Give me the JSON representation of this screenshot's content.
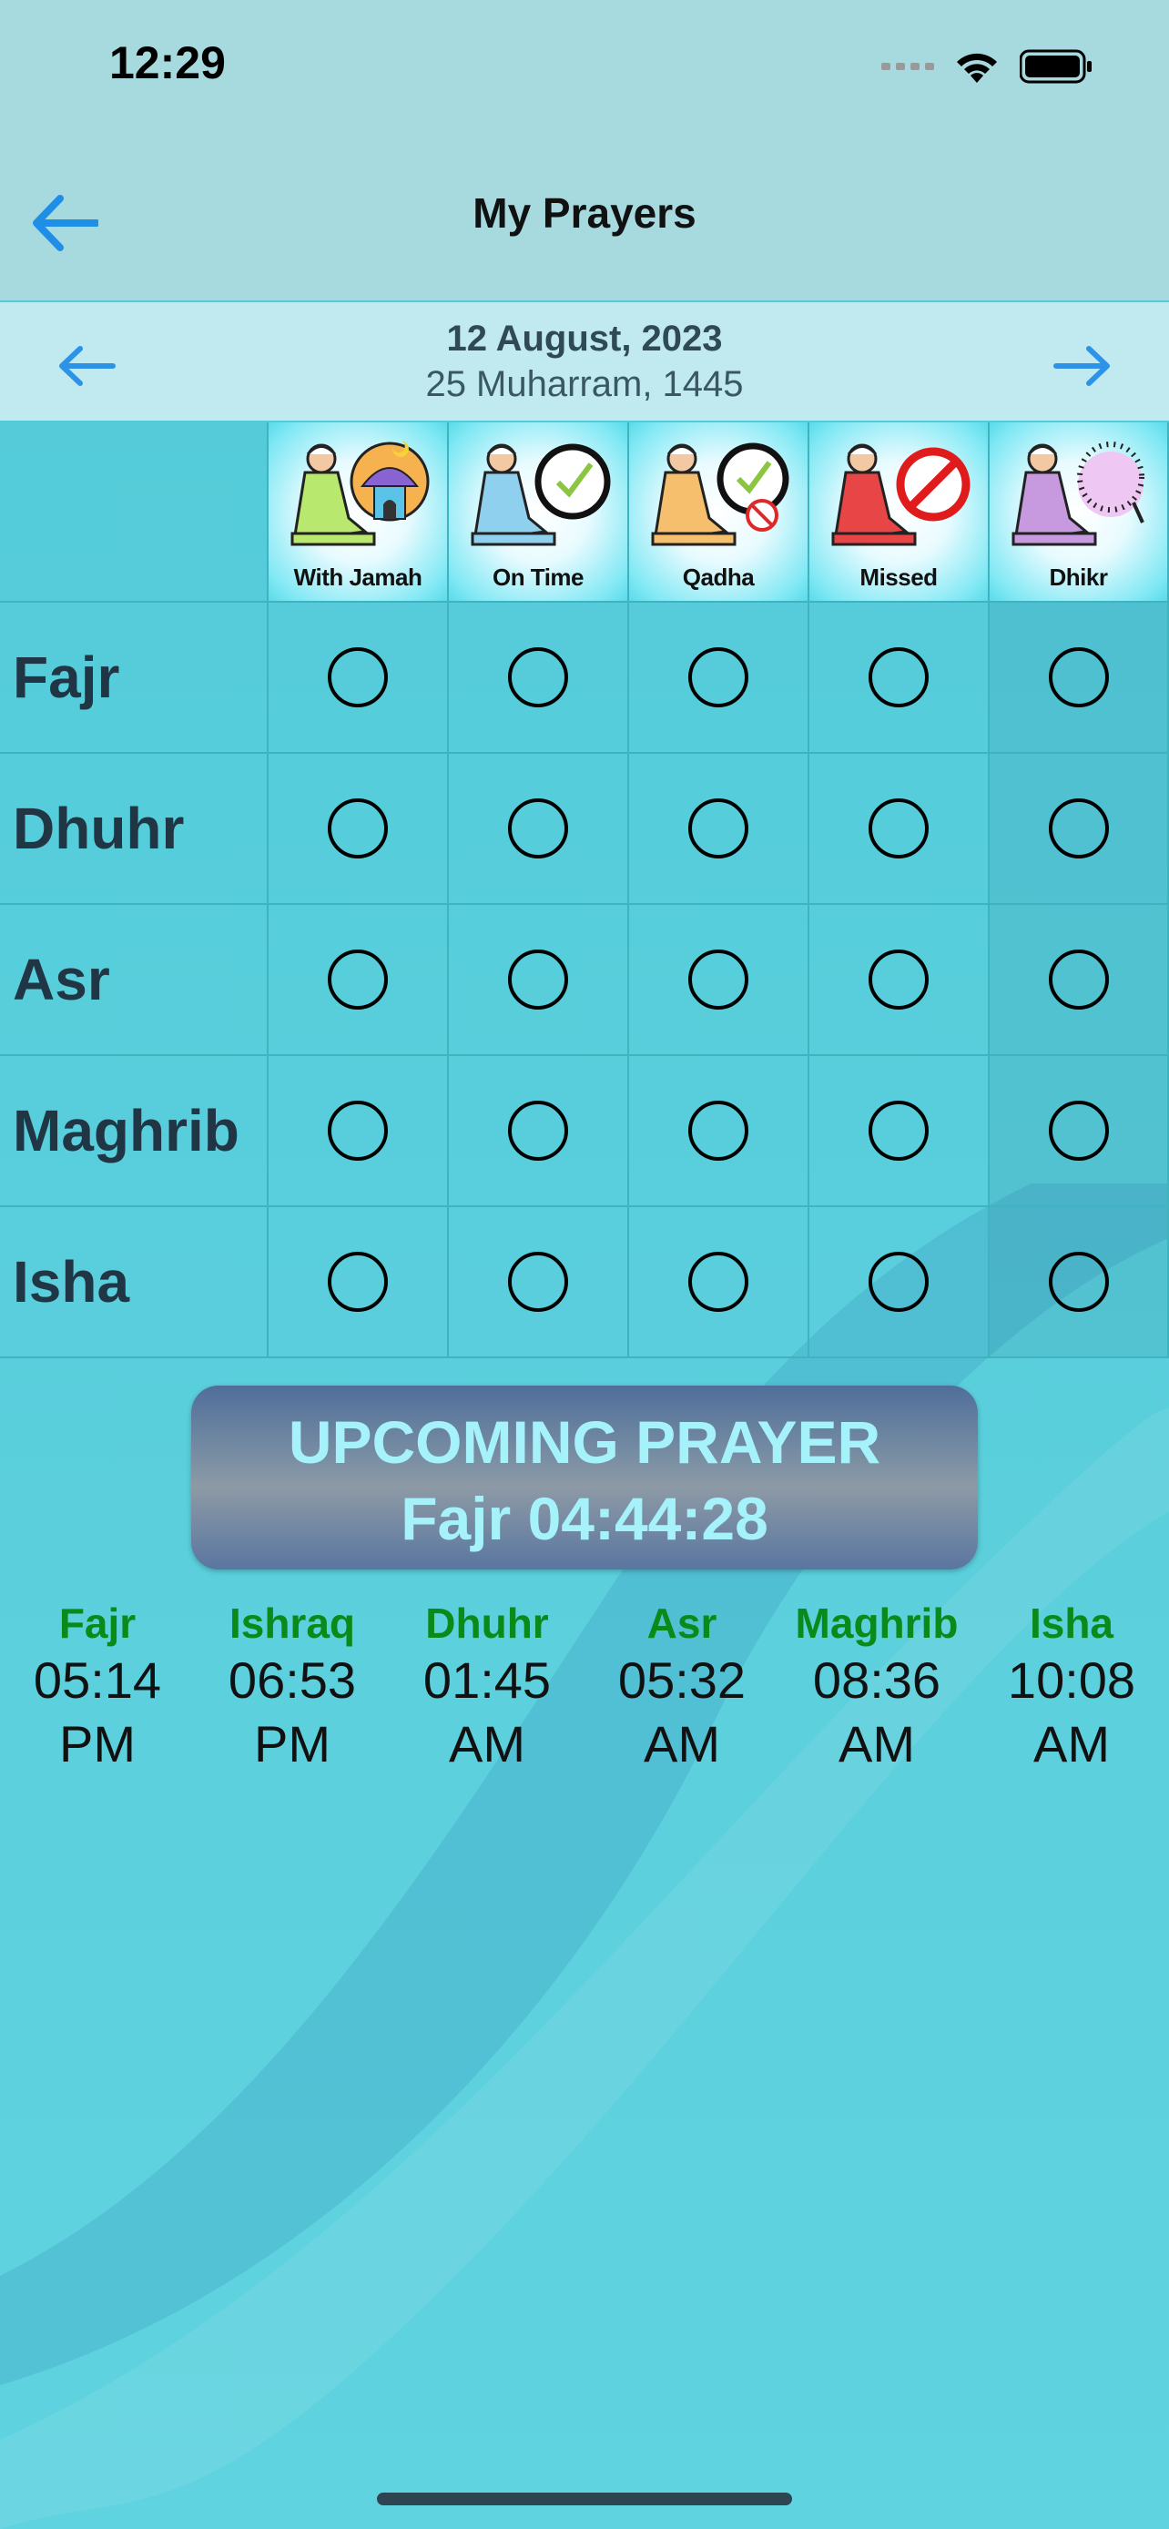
{
  "status": {
    "time": "12:29"
  },
  "nav": {
    "title": "My Prayers"
  },
  "date": {
    "gregorian": "12 August, 2023",
    "hijri": "25 Muharram, 1445"
  },
  "columns": [
    {
      "label": "With Jamah",
      "icon": "prayer-jamah-icon"
    },
    {
      "label": "On Time",
      "icon": "prayer-on-time-icon"
    },
    {
      "label": "Qadha",
      "icon": "prayer-qadha-icon"
    },
    {
      "label": "Missed",
      "icon": "prayer-missed-icon"
    },
    {
      "label": "Dhikr",
      "icon": "dhikr-beads-icon"
    }
  ],
  "prayers": [
    "Fajr",
    "Dhuhr",
    "Asr",
    "Maghrib",
    "Isha"
  ],
  "upcoming": {
    "heading": "UPCOMING PRAYER",
    "countdown": "Fajr 04:44:28"
  },
  "times": [
    {
      "name": "Fajr",
      "time": "05:14",
      "ampm": "PM"
    },
    {
      "name": "Ishraq",
      "time": "06:53",
      "ampm": "PM"
    },
    {
      "name": "Dhuhr",
      "time": "01:45",
      "ampm": "AM"
    },
    {
      "name": "Asr",
      "time": "05:32",
      "ampm": "AM"
    },
    {
      "name": "Maghrib",
      "time": "08:36",
      "ampm": "AM"
    },
    {
      "name": "Isha",
      "time": "10:08",
      "ampm": "AM"
    }
  ],
  "colors": {
    "accent": "#1f8ee6",
    "time_name": "#0a8a18",
    "upcoming_text": "#a6f2fb"
  }
}
